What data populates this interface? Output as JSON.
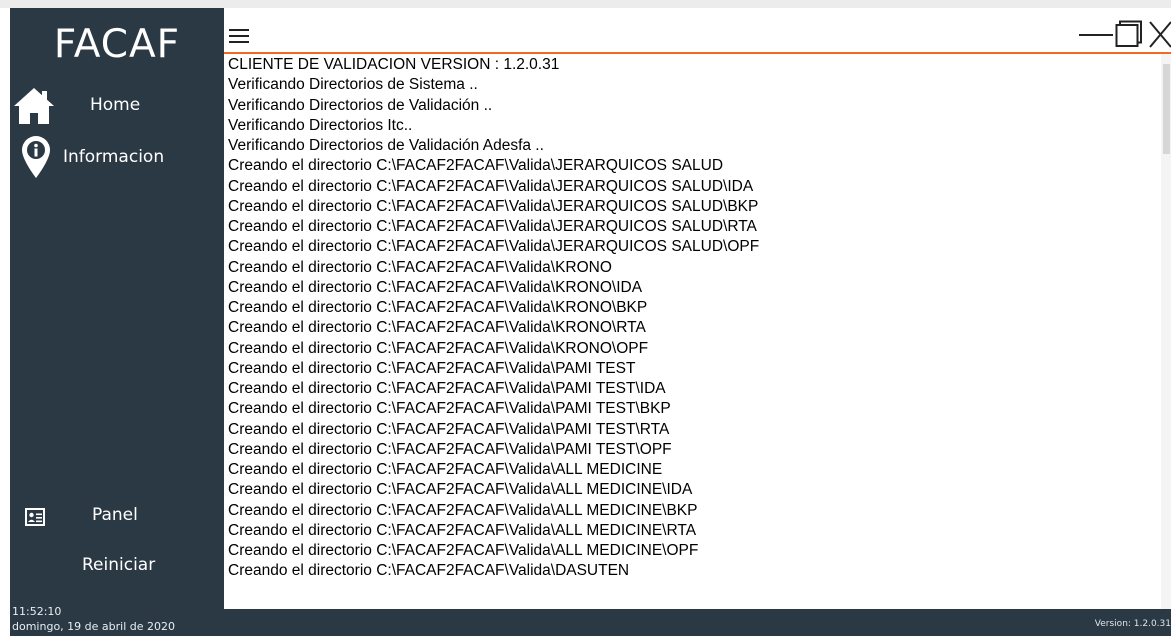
{
  "app": {
    "brand": "FACAF"
  },
  "sidebar": {
    "items": [
      {
        "label": "Home",
        "icon": "home-icon"
      },
      {
        "label": "Informacion",
        "icon": "location-info-icon"
      },
      {
        "label": "Panel",
        "icon": "id-card-icon"
      },
      {
        "label": "Reiniciar"
      }
    ],
    "time": "11:52:10",
    "date": "domingo, 19 de abril de 2020"
  },
  "titlebar": {
    "menu_icon": "hamburger-icon",
    "controls": [
      "minimize-icon",
      "maximize-icon",
      "close-icon"
    ]
  },
  "log": [
    "CLIENTE DE VALIDACION VERSION : 1.2.0.31",
    "Verificando Directorios de Sistema ..",
    "Verificando Directorios de Validación ..",
    "Verificando Directorios Itc..",
    "Verificando Directorios de Validación Adesfa ..",
    "Creando el directorio C:\\FACAF2FACAF\\Valida\\JERARQUICOS SALUD",
    "Creando el directorio C:\\FACAF2FACAF\\Valida\\JERARQUICOS SALUD\\IDA",
    "Creando el directorio C:\\FACAF2FACAF\\Valida\\JERARQUICOS SALUD\\BKP",
    "Creando el directorio C:\\FACAF2FACAF\\Valida\\JERARQUICOS SALUD\\RTA",
    "Creando el directorio C:\\FACAF2FACAF\\Valida\\JERARQUICOS SALUD\\OPF",
    "Creando el directorio C:\\FACAF2FACAF\\Valida\\KRONO",
    "Creando el directorio C:\\FACAF2FACAF\\Valida\\KRONO\\IDA",
    "Creando el directorio C:\\FACAF2FACAF\\Valida\\KRONO\\BKP",
    "Creando el directorio C:\\FACAF2FACAF\\Valida\\KRONO\\RTA",
    "Creando el directorio C:\\FACAF2FACAF\\Valida\\KRONO\\OPF",
    "Creando el directorio C:\\FACAF2FACAF\\Valida\\PAMI TEST",
    "Creando el directorio C:\\FACAF2FACAF\\Valida\\PAMI TEST\\IDA",
    "Creando el directorio C:\\FACAF2FACAF\\Valida\\PAMI TEST\\BKP",
    "Creando el directorio C:\\FACAF2FACAF\\Valida\\PAMI TEST\\RTA",
    "Creando el directorio C:\\FACAF2FACAF\\Valida\\PAMI TEST\\OPF",
    "Creando el directorio C:\\FACAF2FACAF\\Valida\\ALL MEDICINE",
    "Creando el directorio C:\\FACAF2FACAF\\Valida\\ALL MEDICINE\\IDA",
    "Creando el directorio C:\\FACAF2FACAF\\Valida\\ALL MEDICINE\\BKP",
    "Creando el directorio C:\\FACAF2FACAF\\Valida\\ALL MEDICINE\\RTA",
    "Creando el directorio C:\\FACAF2FACAF\\Valida\\ALL MEDICINE\\OPF",
    "Creando el directorio C:\\FACAF2FACAF\\Valida\\DASUTEN"
  ],
  "footer": {
    "version": "Version: 1.2.0.31"
  },
  "colors": {
    "sidebar": "#2b3945",
    "accent": "#f26a21",
    "text": "#000000"
  }
}
